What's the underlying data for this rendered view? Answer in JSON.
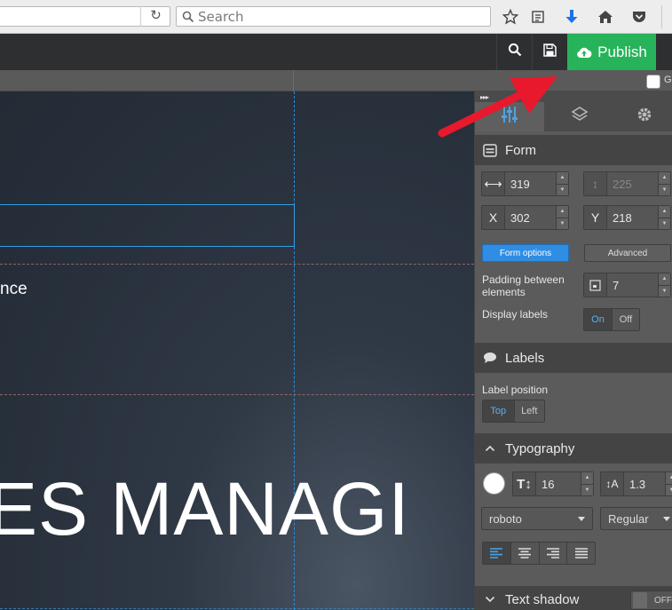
{
  "browser": {
    "search_placeholder": "Search",
    "reload_icon": "reload-icon"
  },
  "app_bar": {
    "publish_label": "Publish",
    "accent": "#27b35a"
  },
  "ruler": {
    "grid_label": "G"
  },
  "canvas": {
    "text_small": "nce",
    "headline": "ES MANAGI"
  },
  "panel": {
    "form": {
      "title": "Form",
      "width": "319",
      "height": "225",
      "x_label": "X",
      "x": "302",
      "y_label": "Y",
      "y": "218",
      "form_options_label": "Form options",
      "advanced_label": "Advanced",
      "padding_label": "Padding between elements",
      "padding_value": "7",
      "display_labels_label": "Display labels",
      "on_label": "On",
      "off_label": "Off"
    },
    "labels": {
      "title": "Labels",
      "position_label": "Label position",
      "top_label": "Top",
      "left_label": "Left"
    },
    "typography": {
      "title": "Typography",
      "font_size": "16",
      "line_height": "1.3",
      "font_family": "roboto",
      "font_weight": "Regular"
    },
    "text_shadow": {
      "title": "Text shadow",
      "toggle_label": "OFF"
    }
  }
}
